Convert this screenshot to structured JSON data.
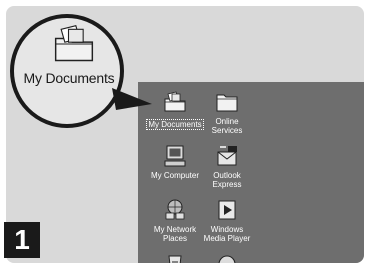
{
  "step": {
    "number": "1"
  },
  "magnifier": {
    "label": "My Documents",
    "icon": "my-documents-folder-icon"
  },
  "desktop": {
    "icons": [
      {
        "label": "My Documents",
        "icon": "my-documents-folder-icon",
        "selected": true
      },
      {
        "label": "Online\nServices",
        "icon": "online-services-folder-icon"
      },
      {
        "label": "My Computer",
        "icon": "my-computer-icon"
      },
      {
        "label": "Outlook\nExpress",
        "icon": "outlook-express-icon"
      },
      {
        "label": "My Network\nPlaces",
        "icon": "my-network-places-icon"
      },
      {
        "label": "Windows\nMedia Player",
        "icon": "windows-media-player-icon"
      },
      {
        "label": "",
        "icon": "recycle-bin-icon"
      },
      {
        "label": "",
        "icon": "internet-explorer-icon"
      }
    ]
  },
  "colors": {
    "desktop": "#6e6e6e",
    "frame": "#d9d9d9",
    "badge": "#1a1a1a"
  }
}
